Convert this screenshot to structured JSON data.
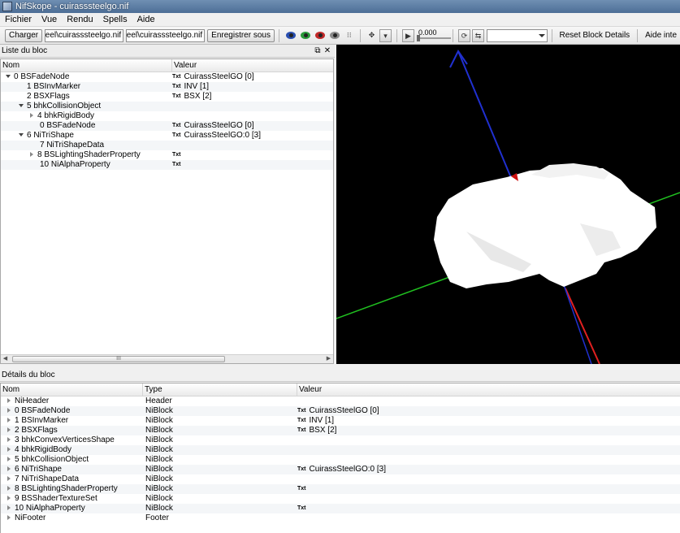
{
  "window": {
    "title": "NifSkope - cuirasssteelgo.nif"
  },
  "menu": [
    "Fichier",
    "Vue",
    "Rendu",
    "Spells",
    "Aide"
  ],
  "toolbar": {
    "load_label": "Charger",
    "load_path": "nor\\steel\\cuirasssteelgo.nif",
    "save_path": "nor\\steel\\cuirasssteelgo.nif",
    "save_label": "Enregistrer sous",
    "time_value": "0.000",
    "reset_label": "Reset Block Details",
    "help_label": "Aide inte"
  },
  "block_list": {
    "title": "Liste du bloc",
    "col_name": "Nom",
    "col_value": "Valeur",
    "rows": [
      {
        "name": "0 BSFadeNode",
        "value": "CuirassSteelGO [0]",
        "txt": "Txt"
      },
      {
        "name": "1 BSInvMarker",
        "value": "INV [1]",
        "txt": "Txt"
      },
      {
        "name": "2 BSXFlags",
        "value": "BSX [2]",
        "txt": "Txt"
      },
      {
        "name": "5 bhkCollisionObject",
        "value": "",
        "txt": ""
      },
      {
        "name": "4 bhkRigidBody",
        "value": "",
        "txt": ""
      },
      {
        "name": "0 BSFadeNode",
        "value": "CuirassSteelGO [0]",
        "txt": "Txt"
      },
      {
        "name": "6 NiTriShape",
        "value": "CuirassSteelGO:0 [3]",
        "txt": "Txt"
      },
      {
        "name": "7 NiTriShapeData",
        "value": "",
        "txt": ""
      },
      {
        "name": "8 BSLightingShaderProperty",
        "value": "",
        "txt": "Txt"
      },
      {
        "name": "10 NiAlphaProperty",
        "value": "",
        "txt": "Txt"
      }
    ],
    "scroll_grip": "III"
  },
  "block_details": {
    "title": "Détails du bloc",
    "col_name": "Nom",
    "col_type": "Type",
    "col_value": "Valeur",
    "rows": [
      {
        "name": "NiHeader",
        "type": "Header",
        "value": "",
        "txt": ""
      },
      {
        "name": "0 BSFadeNode",
        "type": "NiBlock",
        "value": "CuirassSteelGO [0]",
        "txt": "Txt"
      },
      {
        "name": "1 BSInvMarker",
        "type": "NiBlock",
        "value": "INV [1]",
        "txt": "Txt"
      },
      {
        "name": "2 BSXFlags",
        "type": "NiBlock",
        "value": "BSX [2]",
        "txt": "Txt"
      },
      {
        "name": "3 bhkConvexVerticesShape",
        "type": "NiBlock",
        "value": "",
        "txt": ""
      },
      {
        "name": "4 bhkRigidBody",
        "type": "NiBlock",
        "value": "",
        "txt": ""
      },
      {
        "name": "5 bhkCollisionObject",
        "type": "NiBlock",
        "value": "",
        "txt": ""
      },
      {
        "name": "6 NiTriShape",
        "type": "NiBlock",
        "value": "CuirassSteelGO:0 [3]",
        "txt": "Txt"
      },
      {
        "name": "7 NiTriShapeData",
        "type": "NiBlock",
        "value": "",
        "txt": ""
      },
      {
        "name": "8 BSLightingShaderProperty",
        "type": "NiBlock",
        "value": "",
        "txt": "Txt"
      },
      {
        "name": "9 BSShaderTextureSet",
        "type": "NiBlock",
        "value": "",
        "txt": ""
      },
      {
        "name": "10 NiAlphaProperty",
        "type": "NiBlock",
        "value": "",
        "txt": "Txt"
      },
      {
        "name": "NiFooter",
        "type": "Footer",
        "value": "",
        "txt": ""
      }
    ]
  },
  "colors": {
    "axis_blue": "#2030d0",
    "axis_green": "#20c020",
    "axis_red": "#e02020",
    "viewport_bg": "#000000"
  }
}
